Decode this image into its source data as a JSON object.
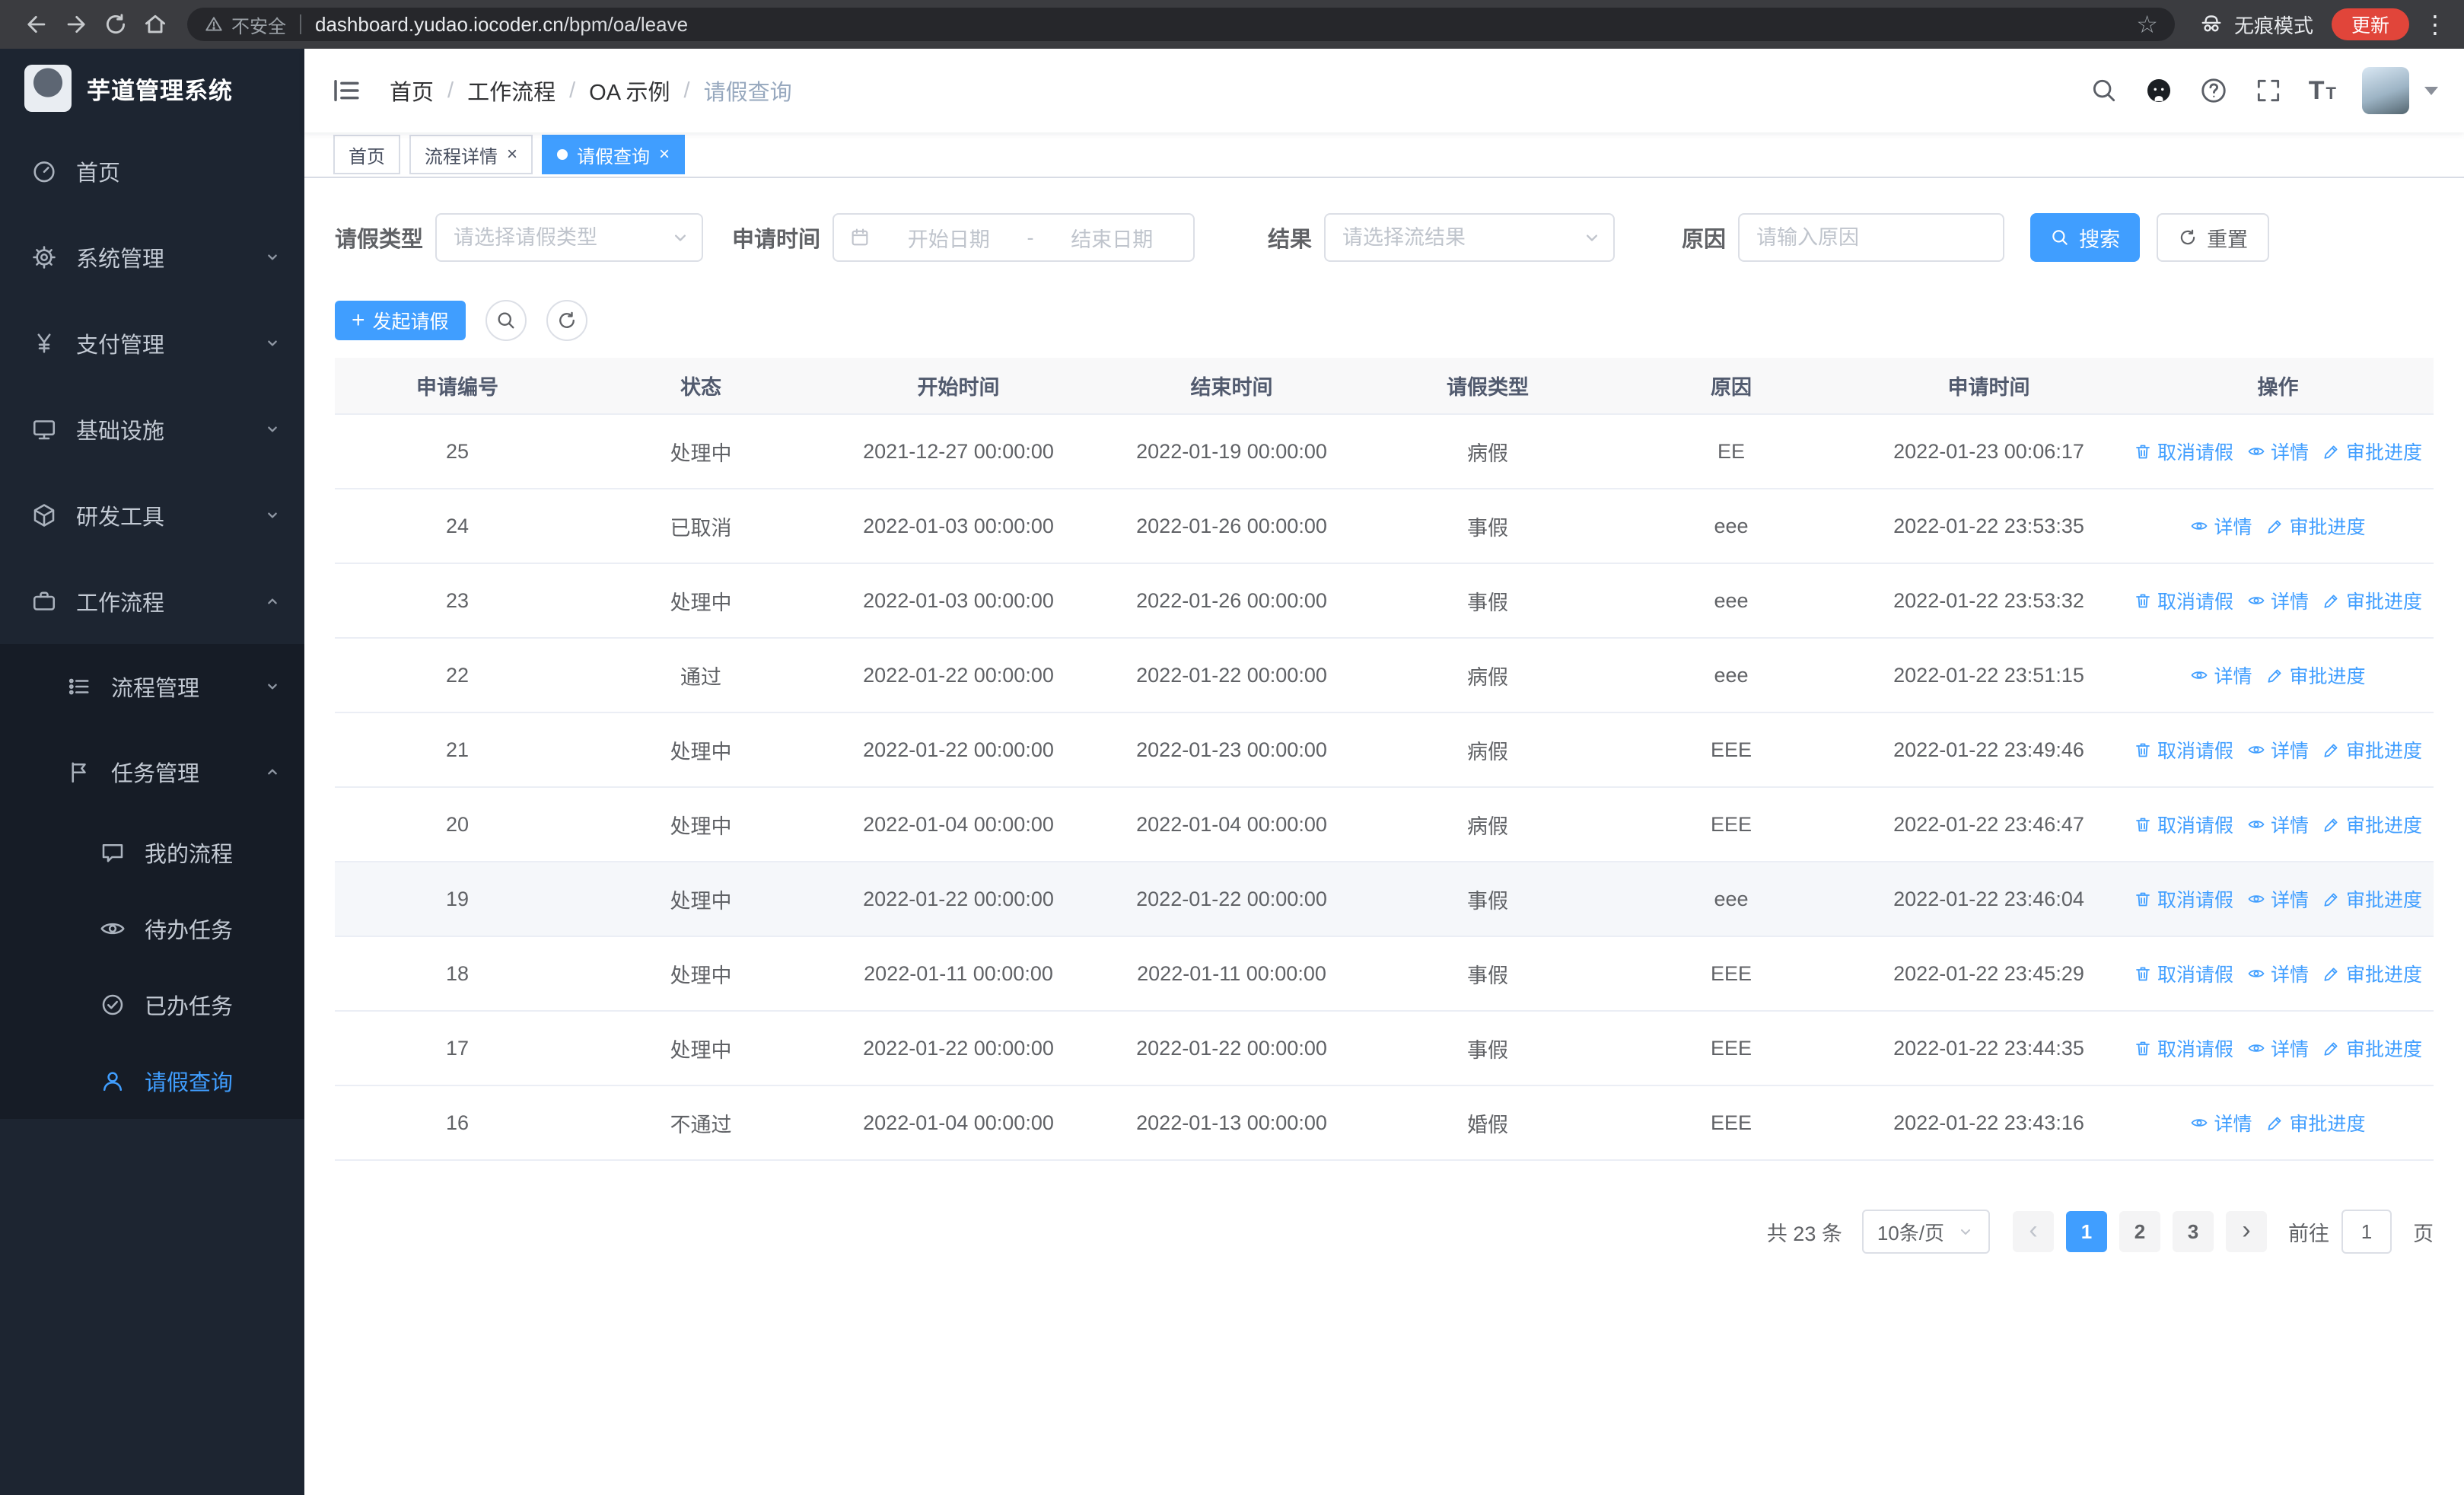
{
  "colors": {
    "primary": "#409eff",
    "sidebar_bg": "#1d2531",
    "sidebar_submenu_bg": "#161c26",
    "update_chip": "#e1453a"
  },
  "icons": {
    "bookmark": "☆",
    "overflow": "⋮",
    "close": "×",
    "plus": "+",
    "prev": "‹",
    "next": "›"
  },
  "chrome": {
    "security_label": "不安全",
    "url_domain": "dashboard.yudao.iocoder.cn",
    "url_path": "/bpm/oa/leave",
    "incognito_label": "无痕模式",
    "update_label": "更新"
  },
  "sidebar": {
    "title": "芋道管理系统",
    "items": [
      {
        "label": "首页"
      },
      {
        "label": "系统管理"
      },
      {
        "label": "支付管理"
      },
      {
        "label": "基础设施"
      },
      {
        "label": "研发工具"
      },
      {
        "label": "工作流程"
      },
      {
        "label": "流程管理"
      },
      {
        "label": "任务管理"
      },
      {
        "label": "我的流程"
      },
      {
        "label": "待办任务"
      },
      {
        "label": "已办任务"
      },
      {
        "label": "请假查询"
      }
    ]
  },
  "header": {
    "breadcrumb": [
      "首页",
      "工作流程",
      "OA 示例",
      "请假查询"
    ],
    "separator": "/"
  },
  "tabs": [
    {
      "label": "首页"
    },
    {
      "label": "流程详情",
      "closable": true
    },
    {
      "label": "请假查询",
      "closable": true,
      "active": true
    }
  ],
  "filters": {
    "leave_type_label": "请假类型",
    "leave_type_placeholder": "请选择请假类型",
    "apply_time_label": "申请时间",
    "start_date_placeholder": "开始日期",
    "range_separator": "-",
    "end_date_placeholder": "结束日期",
    "result_label": "结果",
    "result_placeholder": "请选择流结果",
    "reason_label": "原因",
    "reason_placeholder": "请输入原因",
    "search_label": "搜索",
    "reset_label": "重置"
  },
  "toolbar": {
    "create_label": "发起请假"
  },
  "table": {
    "columns": [
      "申请编号",
      "状态",
      "开始时间",
      "结束时间",
      "请假类型",
      "原因",
      "申请时间",
      "操作"
    ],
    "op_labels": {
      "cancel": "取消请假",
      "detail": "详情",
      "progress": "审批进度"
    },
    "rows": [
      {
        "id": "25",
        "status": "处理中",
        "start": "2021-12-27 00:00:00",
        "end": "2022-01-19 00:00:00",
        "type": "病假",
        "reason": "EE",
        "apply_time": "2022-01-23 00:06:17",
        "ops": [
          "cancel",
          "detail",
          "progress"
        ]
      },
      {
        "id": "24",
        "status": "已取消",
        "start": "2022-01-03 00:00:00",
        "end": "2022-01-26 00:00:00",
        "type": "事假",
        "reason": "eee",
        "apply_time": "2022-01-22 23:53:35",
        "ops": [
          "detail",
          "progress"
        ]
      },
      {
        "id": "23",
        "status": "处理中",
        "start": "2022-01-03 00:00:00",
        "end": "2022-01-26 00:00:00",
        "type": "事假",
        "reason": "eee",
        "apply_time": "2022-01-22 23:53:32",
        "ops": [
          "cancel",
          "detail",
          "progress"
        ]
      },
      {
        "id": "22",
        "status": "通过",
        "start": "2022-01-22 00:00:00",
        "end": "2022-01-22 00:00:00",
        "type": "病假",
        "reason": "eee",
        "apply_time": "2022-01-22 23:51:15",
        "ops": [
          "detail",
          "progress"
        ]
      },
      {
        "id": "21",
        "status": "处理中",
        "start": "2022-01-22 00:00:00",
        "end": "2022-01-23 00:00:00",
        "type": "病假",
        "reason": "EEE",
        "apply_time": "2022-01-22 23:49:46",
        "ops": [
          "cancel",
          "detail",
          "progress"
        ]
      },
      {
        "id": "20",
        "status": "处理中",
        "start": "2022-01-04 00:00:00",
        "end": "2022-01-04 00:00:00",
        "type": "病假",
        "reason": "EEE",
        "apply_time": "2022-01-22 23:46:47",
        "ops": [
          "cancel",
          "detail",
          "progress"
        ]
      },
      {
        "id": "19",
        "status": "处理中",
        "start": "2022-01-22 00:00:00",
        "end": "2022-01-22 00:00:00",
        "type": "事假",
        "reason": "eee",
        "apply_time": "2022-01-22 23:46:04",
        "ops": [
          "cancel",
          "detail",
          "progress"
        ],
        "hover": true
      },
      {
        "id": "18",
        "status": "处理中",
        "start": "2022-01-11 00:00:00",
        "end": "2022-01-11 00:00:00",
        "type": "事假",
        "reason": "EEE",
        "apply_time": "2022-01-22 23:45:29",
        "ops": [
          "cancel",
          "detail",
          "progress"
        ]
      },
      {
        "id": "17",
        "status": "处理中",
        "start": "2022-01-22 00:00:00",
        "end": "2022-01-22 00:00:00",
        "type": "事假",
        "reason": "EEE",
        "apply_time": "2022-01-22 23:44:35",
        "ops": [
          "cancel",
          "detail",
          "progress"
        ]
      },
      {
        "id": "16",
        "status": "不通过",
        "start": "2022-01-04 00:00:00",
        "end": "2022-01-13 00:00:00",
        "type": "婚假",
        "reason": "EEE",
        "apply_time": "2022-01-22 23:43:16",
        "ops": [
          "detail",
          "progress"
        ]
      }
    ]
  },
  "pagination": {
    "total_label": "共 23 条",
    "page_size": "10条/页",
    "pages": [
      "1",
      "2",
      "3"
    ],
    "active_page": "1",
    "goto_label": "前往",
    "goto_value": "1",
    "page_unit": "页"
  }
}
